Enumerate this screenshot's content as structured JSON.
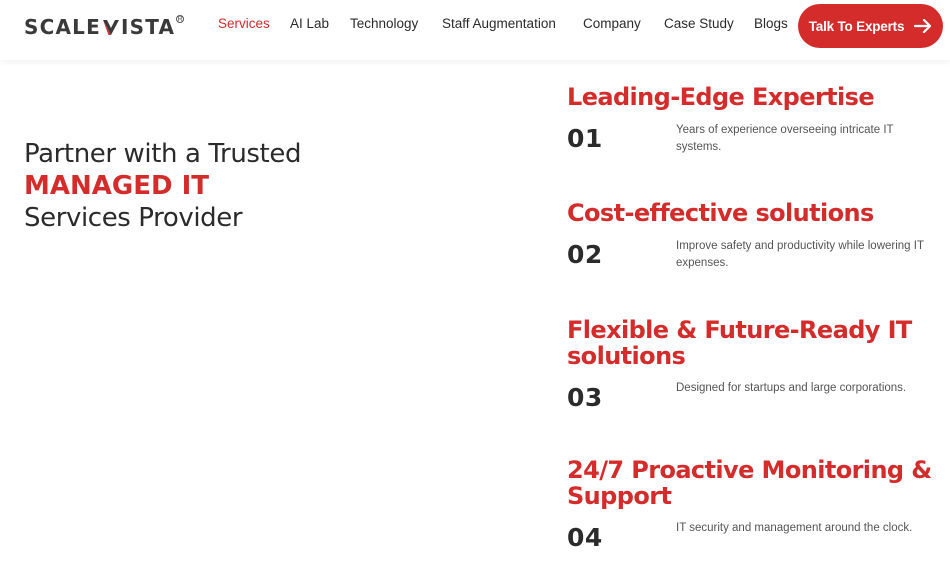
{
  "brand": {
    "name_part1": "SCALE",
    "name_part2": "ISTA",
    "accent_color": "#d42b2b",
    "text_color": "#2b2b2b"
  },
  "nav": {
    "items": [
      {
        "label": "Services",
        "active": true
      },
      {
        "label": "AI Lab",
        "active": false
      },
      {
        "label": "Technology",
        "active": false
      },
      {
        "label": "Staff Augmentation",
        "active": false
      },
      {
        "label": "Company",
        "active": false
      },
      {
        "label": "Case Study",
        "active": false
      },
      {
        "label": "Blogs",
        "active": false
      }
    ],
    "cta_label": "Talk To Experts",
    "cta_icon": "arrow-right-icon"
  },
  "hero": {
    "line1": "Partner with a Trusted",
    "line2": "MANAGED IT",
    "line3": "Services Provider"
  },
  "features": [
    {
      "title_lines": [
        "Leading-Edge Expertise"
      ],
      "number": "01",
      "desc": "Years of experience overseeing intricate IT systems."
    },
    {
      "title_lines": [
        "Cost-effective solutions"
      ],
      "number": "02",
      "desc": "Improve safety and productivity while lowering IT expenses."
    },
    {
      "title_lines": [
        "Flexible & Future-Ready IT",
        "solutions"
      ],
      "number": "03",
      "desc": "Designed for startups and large corporations."
    },
    {
      "title_lines": [
        "24/7 Proactive Monitoring &",
        "Support"
      ],
      "number": "04",
      "desc": "IT security and management around the clock."
    }
  ]
}
